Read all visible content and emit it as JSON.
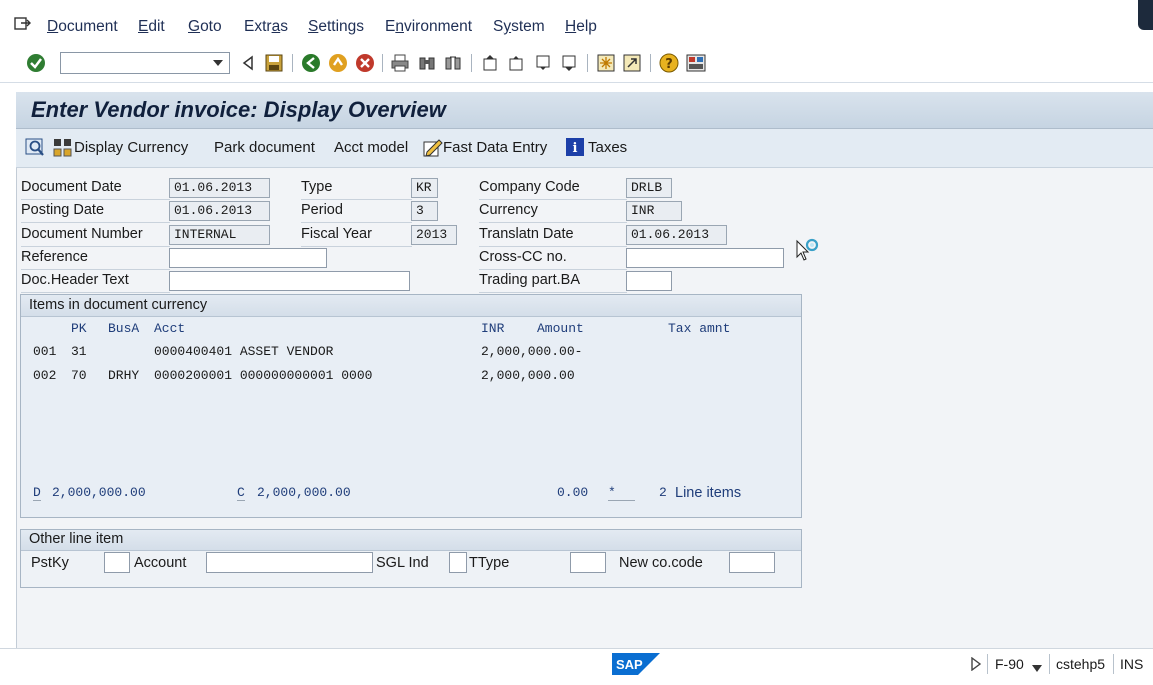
{
  "menu": {
    "items": [
      {
        "label": "Document",
        "u": "D",
        "rest": "ocument"
      },
      {
        "label": "Edit",
        "u": "E",
        "rest": "dit"
      },
      {
        "label": "Goto",
        "u": "G",
        "rest": "oto"
      },
      {
        "label": "Extras",
        "pre": "Extr",
        "u": "a",
        "rest": "s"
      },
      {
        "label": "Settings",
        "u": "S",
        "rest": "ettings"
      },
      {
        "label": "Environment",
        "pre": "E",
        "u": "n",
        "rest": "vironment"
      },
      {
        "label": "System",
        "pre": "S",
        "u": "y",
        "rest": "stem"
      },
      {
        "label": "Help",
        "u": "H",
        "rest": "elp"
      }
    ]
  },
  "toolbar": {
    "command_value": ""
  },
  "page": {
    "title": "Enter Vendor invoice: Display Overview"
  },
  "app_toolbar": {
    "display_currency": "Display Currency",
    "park_document": "Park document",
    "acct_model": "Acct model",
    "fast_data_entry": "Fast Data Entry",
    "taxes": "Taxes"
  },
  "header": {
    "document_date": {
      "label": "Document Date",
      "value": "01.06.2013"
    },
    "posting_date": {
      "label": "Posting Date",
      "value": "01.06.2013"
    },
    "document_number": {
      "label": "Document Number",
      "value": "INTERNAL"
    },
    "reference": {
      "label": "Reference",
      "value": ""
    },
    "doc_header_text": {
      "label": "Doc.Header Text",
      "value": ""
    },
    "type": {
      "label": "Type",
      "value": "KR"
    },
    "period": {
      "label": "Period",
      "value": "3"
    },
    "fiscal_year": {
      "label": "Fiscal Year",
      "value": "2013"
    },
    "company_code": {
      "label": "Company Code",
      "value": "DRLB"
    },
    "currency": {
      "label": "Currency",
      "value": "INR"
    },
    "translatn_date": {
      "label": "Translatn Date",
      "value": "01.06.2013"
    },
    "cross_cc": {
      "label": "Cross-CC no.",
      "value": ""
    },
    "trading_part": {
      "label": "Trading part.BA",
      "value": ""
    }
  },
  "items": {
    "title": "Items in document currency",
    "columns": {
      "pk": "PK",
      "busa": "BusA",
      "acct": "Acct",
      "currency": "INR",
      "amount": "Amount",
      "tax_amnt": "Tax amnt"
    },
    "rows": [
      {
        "no": "001",
        "pk": "31",
        "busa": "",
        "acct_text": "0000400401 ASSET VENDOR",
        "amount": "2,000,000.00-"
      },
      {
        "no": "002",
        "pk": "70",
        "busa": "DRHY",
        "acct_text": "0000200001 000000000001 0000",
        "amount": "2,000,000.00"
      }
    ],
    "totals": {
      "debit_label": "D",
      "debit_value": "2,000,000.00",
      "credit_label": "C",
      "credit_value": "2,000,000.00",
      "balance": "0.00",
      "flag": "*",
      "line_count": "2",
      "line_items_label": "Line items"
    }
  },
  "other_line_item": {
    "title": "Other line item",
    "pstky_label": "PstKy",
    "account_label": "Account",
    "sgl_ind_label": "SGL Ind",
    "ttype_label": "TType",
    "new_cocode_label": "New co.code"
  },
  "status": {
    "transaction": "F-90",
    "server": "cstehp5",
    "mode": "INS",
    "logo_text": "SAP"
  },
  "colors": {
    "title_bar": "#c6d4e2",
    "panel": "#f2f4f7",
    "link_blue": "#1f3d7a",
    "sap_blue": "#0a6ed1"
  }
}
